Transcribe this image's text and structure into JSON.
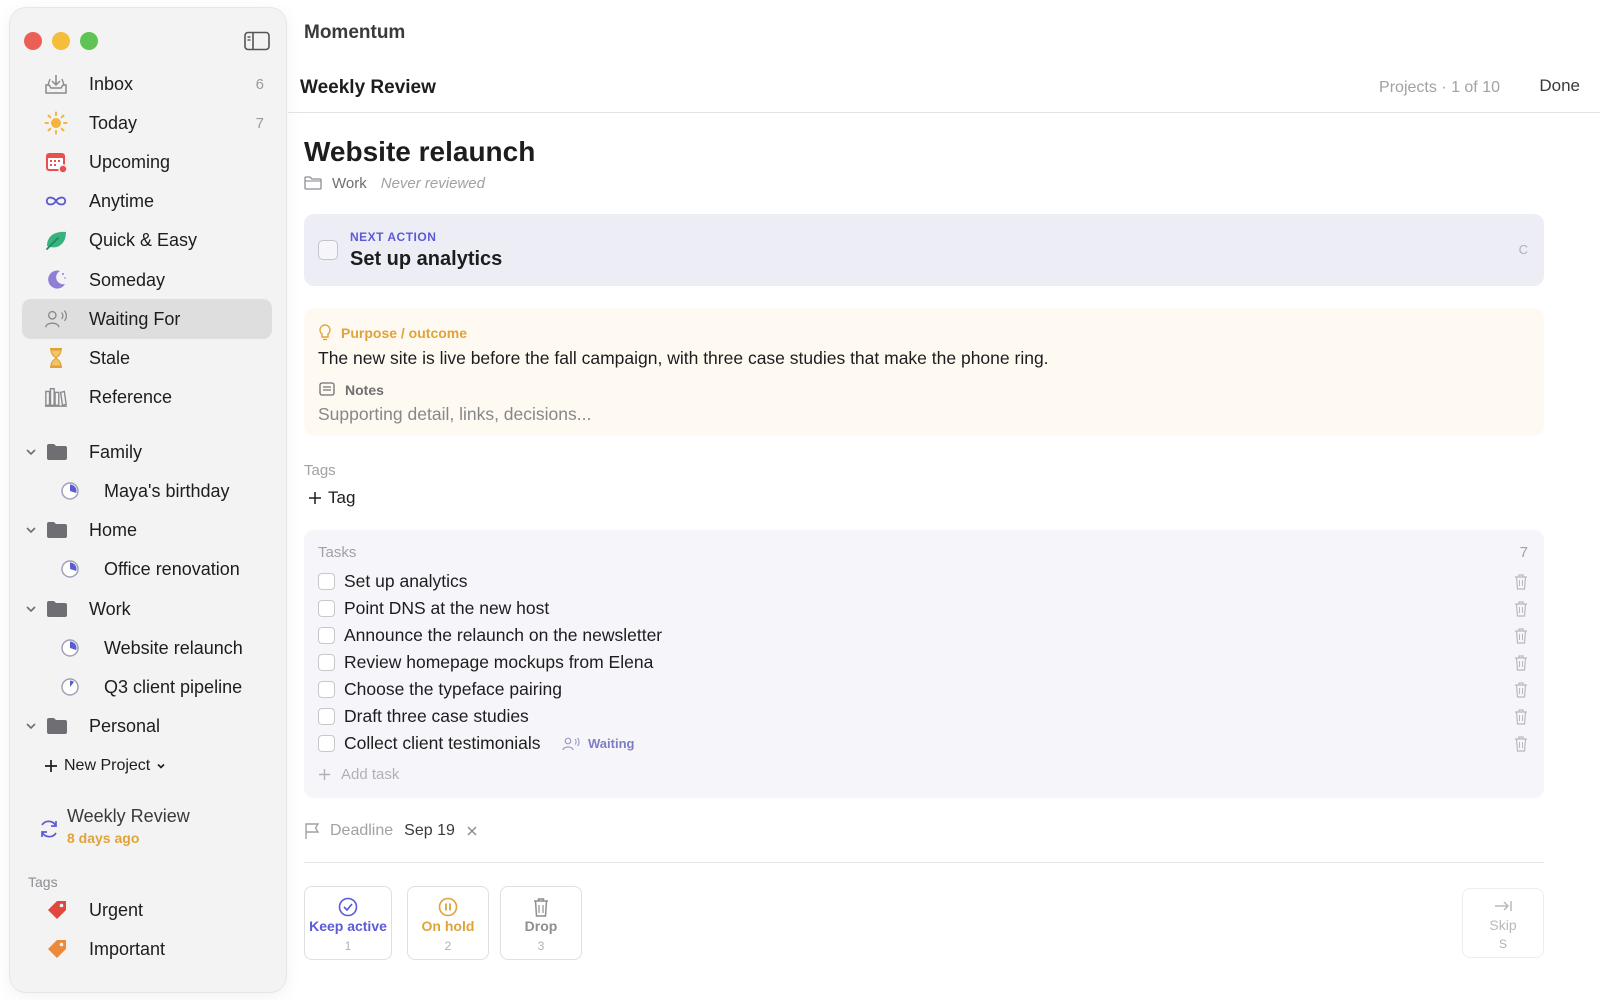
{
  "app": {
    "title": "Momentum"
  },
  "header": {
    "view_title": "Weekly Review",
    "progress": "Projects · 1 of 10",
    "done_label": "Done"
  },
  "sidebar": {
    "nav": [
      {
        "label": "Inbox",
        "count": "6",
        "icon": "inbox-icon"
      },
      {
        "label": "Today",
        "count": "7",
        "icon": "sun-icon"
      },
      {
        "label": "Upcoming",
        "count": "",
        "icon": "calendar-icon"
      },
      {
        "label": "Anytime",
        "count": "",
        "icon": "infinity-icon"
      },
      {
        "label": "Quick & Easy",
        "count": "",
        "icon": "leaf-icon"
      },
      {
        "label": "Someday",
        "count": "",
        "icon": "moon-icon"
      },
      {
        "label": "Waiting For",
        "count": "",
        "icon": "waiting-person-icon",
        "active": true
      },
      {
        "label": "Stale",
        "count": "",
        "icon": "hourglass-icon"
      },
      {
        "label": "Reference",
        "count": "",
        "icon": "books-icon"
      }
    ],
    "groups": [
      {
        "label": "Family",
        "projects": [
          "Maya's birthday"
        ]
      },
      {
        "label": "Home",
        "projects": [
          "Office renovation"
        ]
      },
      {
        "label": "Work",
        "projects": [
          "Website relaunch",
          "Q3 client pipeline"
        ]
      },
      {
        "label": "Personal",
        "projects": []
      }
    ],
    "new_project_label": "New Project",
    "weekly_review": {
      "title": "Weekly Review",
      "subtitle": "8 days ago"
    },
    "tags_heading": "Tags",
    "tags": [
      {
        "label": "Urgent",
        "color": "#e0483e"
      },
      {
        "label": "Important",
        "color": "#ea8a3a"
      }
    ]
  },
  "project": {
    "title": "Website relaunch",
    "area": "Work",
    "review_status": "Never reviewed",
    "next_action": {
      "kicker": "NEXT ACTION",
      "title": "Set up analytics",
      "shortcut": "C"
    },
    "purpose": {
      "kicker": "Purpose / outcome",
      "text": "The new site is live before the fall campaign, with three case studies that make the phone ring."
    },
    "notes": {
      "kicker": "Notes",
      "placeholder": "Supporting detail, links, decisions..."
    },
    "tags_label": "Tags",
    "add_tag_label": "Tag",
    "tasks_heading": "Tasks",
    "tasks_count": "7",
    "tasks": [
      {
        "label": "Set up analytics"
      },
      {
        "label": "Point DNS at the new host"
      },
      {
        "label": "Announce the relaunch on the newsletter"
      },
      {
        "label": "Review homepage mockups from Elena"
      },
      {
        "label": "Choose the typeface pairing"
      },
      {
        "label": "Draft three case studies"
      },
      {
        "label": "Collect client testimonials",
        "status": "Waiting"
      }
    ],
    "add_task_label": "Add task",
    "deadline": {
      "label": "Deadline",
      "value": "Sep 19"
    }
  },
  "actions": [
    {
      "label": "Keep active",
      "key": "1",
      "color": "#5b5bd6"
    },
    {
      "label": "On hold",
      "key": "2",
      "color": "#e0a33a"
    },
    {
      "label": "Drop",
      "key": "3",
      "color": "#8e8e93"
    }
  ],
  "skip": {
    "label": "Skip",
    "key": "S"
  },
  "colors": {
    "accent": "#5b5bd6",
    "warning": "#e0a33a",
    "sidebar_bg": "#f3f3f3"
  }
}
